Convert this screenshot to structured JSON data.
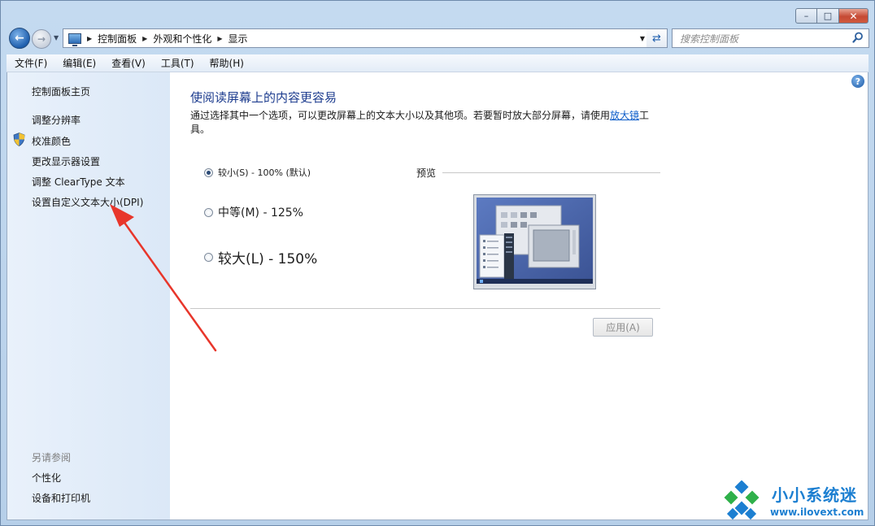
{
  "window": {
    "caption_minimize": "–",
    "caption_maximize": "□",
    "caption_close": "✕"
  },
  "address": {
    "crumbs": [
      "控制面板",
      "外观和个性化",
      "显示"
    ],
    "search_placeholder": "搜索控制面板"
  },
  "menu": {
    "items": [
      "文件(F)",
      "编辑(E)",
      "查看(V)",
      "工具(T)",
      "帮助(H)"
    ]
  },
  "sidebar": {
    "links": [
      "控制面板主页",
      "调整分辨率",
      "校准颜色",
      "更改显示器设置",
      "调整 ClearType 文本",
      "设置自定义文本大小(DPI)"
    ],
    "see_also_heading": "另请参阅",
    "see_also_links": [
      "个性化",
      "设备和打印机"
    ]
  },
  "main": {
    "title": "使阅读屏幕上的内容更容易",
    "description_before": "通过选择其中一个选项，可以更改屏幕上的文本大小以及其他项。若要暂时放大部分屏幕，请使用",
    "magnifier_link": "放大镜",
    "description_after": "工具。",
    "options": [
      {
        "label": "较小(S) - 100% (默认)",
        "checked": true
      },
      {
        "label": "中等(M) - 125%",
        "checked": false
      },
      {
        "label": "较大(L) - 150%",
        "checked": false
      }
    ],
    "preview_label": "预览",
    "apply_label": "应用(A)",
    "help_glyph": "?"
  },
  "watermark": {
    "title": "小小系统迷",
    "url": "www.ilovext.com"
  },
  "colors": {
    "title_blue": "#1e3d8f",
    "link_blue": "#0b5cc9",
    "arrow_red": "#e8362b",
    "watermark_blue": "#1c7fd1"
  },
  "icons": {
    "back": "back-arrow-icon",
    "forward": "forward-arrow-icon",
    "address": "computer-monitor-icon",
    "refresh": "refresh-icon",
    "search": "search-icon",
    "help": "help-icon",
    "shield": "uac-shield-icon"
  }
}
